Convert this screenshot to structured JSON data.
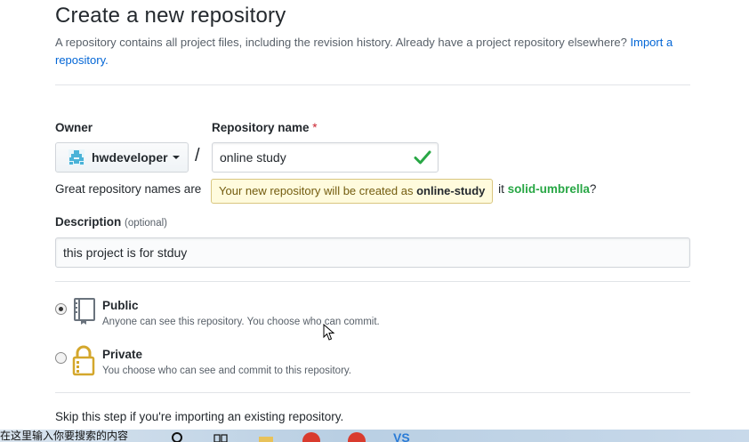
{
  "page": {
    "title": "Create a new repository",
    "subhead_text": "A repository contains all project files, including the revision history. Already have a project repository elsewhere?",
    "import_link": "Import a repository."
  },
  "owner": {
    "label": "Owner",
    "selected": "hwdeveloper",
    "icon": "avatar-icon"
  },
  "repo_name": {
    "label": "Repository name",
    "required_mark": "*",
    "value": "online study",
    "valid_icon": "check-icon"
  },
  "separator": "/",
  "helper": {
    "prefix": "Great repository names are",
    "tail": "it",
    "suggestion": "solid-umbrella",
    "suffix": "?"
  },
  "tooltip": {
    "text": "Your new repository will be created as",
    "name": "online-study"
  },
  "description": {
    "label": "Description",
    "optional": "(optional)",
    "value": "this project is for stduy"
  },
  "visibility": {
    "options": [
      {
        "title": "Public",
        "note": "Anyone can see this repository. You choose who can commit.",
        "selected": true,
        "icon": "repo-book-icon"
      },
      {
        "title": "Private",
        "note": "You choose who can see and commit to this repository.",
        "selected": false,
        "icon": "lock-icon"
      }
    ]
  },
  "skip_text": "Skip this step if you're importing an existing repository.",
  "taskbar": {
    "search_text": "在这里输入你要搜索的内容",
    "icons": [
      "search-icon",
      "task-view-icon",
      "file-explorer-icon",
      "browser-icon",
      "browser-icon",
      "vs-code-icon"
    ]
  },
  "colors": {
    "link": "#0366d6",
    "success": "#28a745",
    "required": "#cb2431",
    "tooltip_bg": "#fffbdd"
  }
}
